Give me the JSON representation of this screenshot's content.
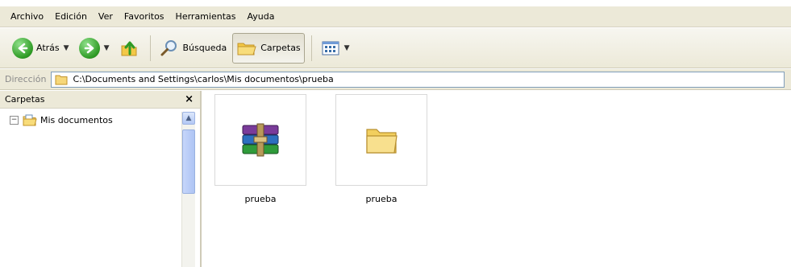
{
  "menu": [
    "Archivo",
    "Edición",
    "Ver",
    "Favoritos",
    "Herramientas",
    "Ayuda"
  ],
  "toolbar": {
    "back_label": "Atrás",
    "search_label": "Búsqueda",
    "folders_label": "Carpetas"
  },
  "address": {
    "label": "Dirección",
    "path": "C:\\Documents and Settings\\carlos\\Mis documentos\\prueba"
  },
  "folders_pane": {
    "title": "Carpetas",
    "close": "×",
    "tree": [
      {
        "label": "Mis documentos",
        "expander": "−"
      }
    ]
  },
  "files": [
    {
      "name": "prueba",
      "icon": "winrar-archive-icon"
    },
    {
      "name": "prueba",
      "icon": "folder-icon"
    }
  ],
  "colors": {
    "chrome": "#ece9d8",
    "address_border": "#7f9db9",
    "folder_yellow": "#f6d77a"
  }
}
